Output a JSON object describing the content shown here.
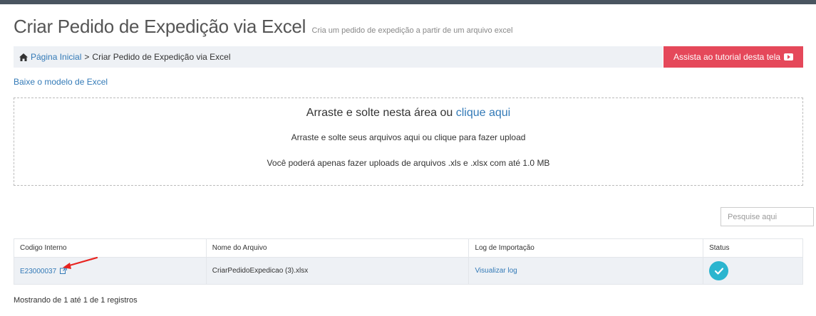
{
  "header": {
    "title": "Criar Pedido de Expedição via Excel",
    "subtitle": "Cria um pedido de expedição a partir de um arquivo excel"
  },
  "breadcrumb": {
    "home": "Página Inicial",
    "separator": ">",
    "current": "Criar Pedido de Expedição via Excel"
  },
  "tutorial_button": {
    "label": "Assista ao tutorial desta tela",
    "icon": "play-video-icon",
    "color": "#e5485a"
  },
  "model_link": "Baixe o modelo de Excel",
  "dropzone": {
    "title_prefix": "Arraste e solte nesta área ou",
    "title_link": "clique aqui",
    "line1": "Arraste e solte seus arquivos aqui ou clique para fazer upload",
    "line2": "Você poderá apenas fazer uploads de arquivos .xls e .xlsx com até 1.0 MB"
  },
  "search": {
    "placeholder": "Pesquise aqui"
  },
  "table": {
    "columns": [
      "Codigo Interno",
      "Nome do Arquivo",
      "Log de Importação",
      "Status"
    ],
    "rows": [
      {
        "codigo": "E23000037",
        "arquivo": "CriarPedidoExpedicao (3).xlsx",
        "log": "Visualizar log",
        "status_icon": "check-icon",
        "status_color": "#2bb5cf"
      }
    ]
  },
  "footer": "Mostrando de 1 até 1 de 1 registros",
  "colors": {
    "link": "#337ab7",
    "bar_bg": "#eef1f5",
    "annotation_arrow": "#e8231f"
  }
}
